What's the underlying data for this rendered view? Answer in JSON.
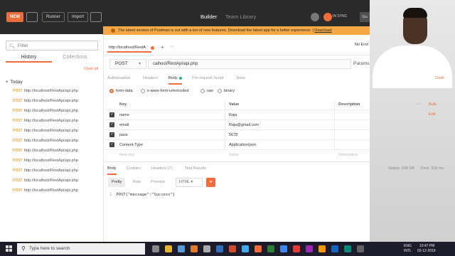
{
  "toolbar": {
    "new_label": "NEW",
    "runner_label": "Runner",
    "import_label": "Import",
    "builder_label": "Builder",
    "team_library_label": "Team Library",
    "sync_label": "IN SYNC",
    "user_label": "Gu"
  },
  "banner": {
    "message": "The latest version of Postman is out with a ton of new features. Download the latest app for a better experience. |",
    "link": "Download"
  },
  "sidebar": {
    "filter_placeholder": "Filter",
    "tabs": [
      "History",
      "Collections"
    ],
    "clear_all": "Clear all",
    "group": "Today",
    "history": [
      {
        "method": "POST",
        "url": "http://localhost/RestApi/api.php"
      },
      {
        "method": "POST",
        "url": "http://localhost/RestApi/api.php"
      },
      {
        "method": "POST",
        "url": "http://localhost/RestApi/api.php"
      },
      {
        "method": "POST",
        "url": "http://localhost/RestApi/api.php"
      },
      {
        "method": "POST",
        "url": "http://localhost/RestApi/api.php"
      },
      {
        "method": "POST",
        "url": "http://localhost/RestApi/api.php"
      },
      {
        "method": "POST",
        "url": "http://localhost/RestApi/api.php"
      },
      {
        "method": "POST",
        "url": "http://localhost/RestApi/api.php"
      },
      {
        "method": "POST",
        "url": "http://localhost/RestApi/api.php"
      },
      {
        "method": "POST",
        "url": "http://localhost/RestApi/api.php"
      },
      {
        "method": "POST",
        "url": "http://localhost/RestApi/api.php"
      }
    ]
  },
  "request": {
    "tab_label": "http://localhost/RestA",
    "plus": "+",
    "more": "···",
    "env": "No Envi",
    "method": "POST",
    "url": "calhost/RestApi/api.php",
    "params": "Params"
  },
  "request_tabs": {
    "authorization": "Authorization",
    "headers": "Headers",
    "body": "Body",
    "pre_request": "Pre-request Script",
    "tests": "Tests",
    "code": "Code"
  },
  "body_types": [
    "form-data",
    "x-www-form-urlencoded",
    "raw",
    "binary"
  ],
  "kv": {
    "head_key": "Key",
    "head_value": "Value",
    "head_desc": "Description",
    "head_more": "···",
    "bulk_edit": "Bulk Edit",
    "rows": [
      {
        "key": "name",
        "value": "Raja"
      },
      {
        "key": "email",
        "value": "Raja@gmail.com"
      },
      {
        "key": "pass",
        "value": "5678"
      },
      {
        "key": "Content-Type",
        "value": "Application/json"
      }
    ],
    "new_key": "New key",
    "new_value": "Value",
    "new_desc": "Description"
  },
  "response_tabs": {
    "body": "Body",
    "cookies": "Cookies",
    "headers": "Headers (7)",
    "test_results": "Test Results",
    "status": "Status: 200 OK",
    "time": "Time: 318 ms"
  },
  "response_bar": {
    "pretty": "Pretty",
    "raw": "Raw",
    "preview": "Preview",
    "format": "HTML"
  },
  "response": {
    "line_no": "1",
    "text": "POST{\"message\":\"Success\"}"
  },
  "taskbar": {
    "search": "Type here to search",
    "lang": "ENG",
    "locale": "INTL",
    "time": "10:47 PM",
    "date": "02-12-2019"
  },
  "colors": {
    "accent": "#f26b3a",
    "banner": "#f4a742",
    "toolbar": "#2b2b2b"
  }
}
